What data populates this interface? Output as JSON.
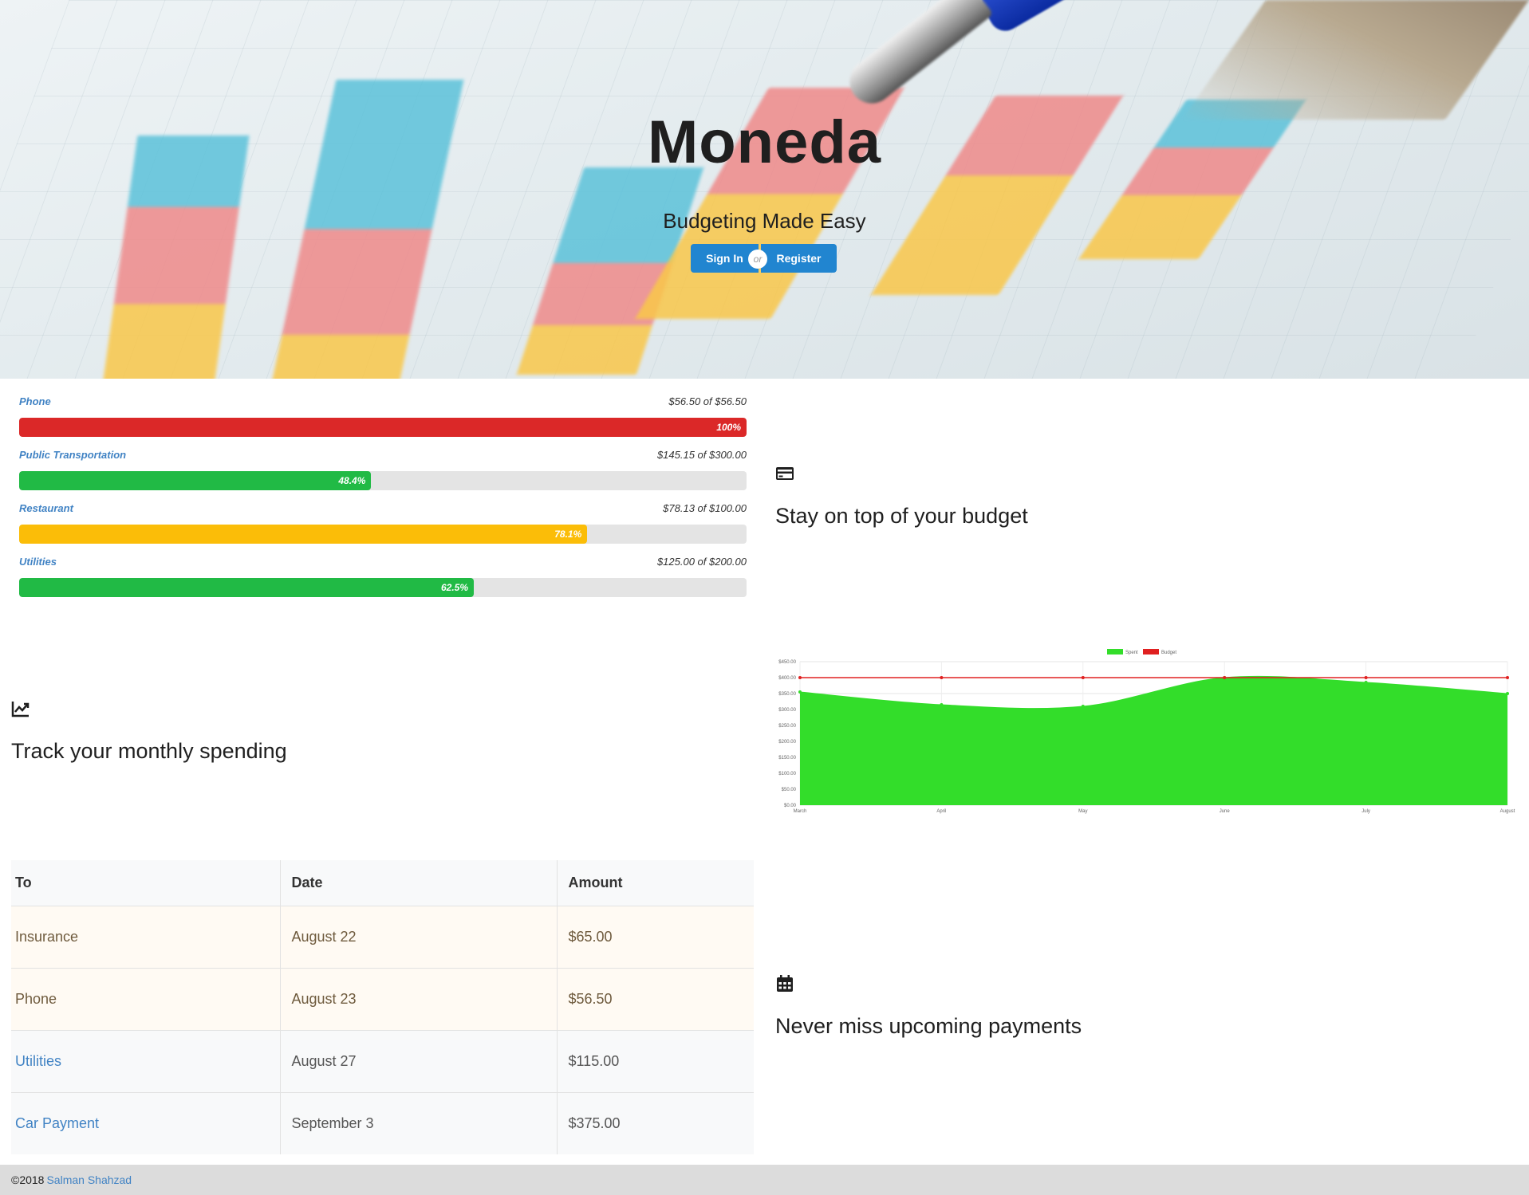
{
  "hero": {
    "title": "Moneda",
    "subtitle": "Budgeting Made Easy",
    "signin_label": "Sign In",
    "or_label": "or",
    "register_label": "Register"
  },
  "budget": {
    "items": [
      {
        "name": "Phone",
        "amount": "$56.50 of $56.50",
        "percent_label": "100%",
        "fraction": 1.0,
        "color": "#db2828"
      },
      {
        "name": "Public Transportation",
        "amount": "$145.15 of $300.00",
        "percent_label": "48.4%",
        "fraction": 0.484,
        "color": "#21ba45"
      },
      {
        "name": "Restaurant",
        "amount": "$78.13 of $100.00",
        "percent_label": "78.1%",
        "fraction": 0.781,
        "color": "#fbbd08"
      },
      {
        "name": "Utilities",
        "amount": "$125.00 of $200.00",
        "percent_label": "62.5%",
        "fraction": 0.625,
        "color": "#21ba45"
      }
    ]
  },
  "features": {
    "budget": {
      "icon": "credit-card-icon",
      "title": "Stay on top of your budget"
    },
    "spending": {
      "icon": "line-chart-icon",
      "title": "Track your monthly spending"
    },
    "payments": {
      "icon": "calendar-icon",
      "title": "Never miss upcoming payments"
    }
  },
  "chart_data": {
    "type": "line",
    "categories": [
      "March",
      "April",
      "May",
      "June",
      "July",
      "August"
    ],
    "series": [
      {
        "name": "Spent",
        "values": [
          355,
          315,
          310,
          400,
          385,
          350
        ],
        "color": "#33dd2a",
        "fill": true
      },
      {
        "name": "Budget",
        "values": [
          400,
          400,
          400,
          400,
          400,
          400
        ],
        "color": "#e02020",
        "fill": false
      }
    ],
    "ylim": [
      0,
      450
    ],
    "yticks": [
      "$0.00",
      "$50.00",
      "$100.00",
      "$150.00",
      "$200.00",
      "$250.00",
      "$300.00",
      "$350.00",
      "$400.00",
      "$450.00"
    ],
    "legend": "top",
    "grid": true
  },
  "payments_table": {
    "headers": [
      "To",
      "Date",
      "Amount"
    ],
    "rows": [
      {
        "to": "Insurance",
        "date": "August 22",
        "amount": "$65.00",
        "style": "warn"
      },
      {
        "to": "Phone",
        "date": "August 23",
        "amount": "$56.50",
        "style": "warn"
      },
      {
        "to": "Utilities",
        "date": "August 27",
        "amount": "$115.00",
        "style": "plain"
      },
      {
        "to": "Car Payment",
        "date": "September 3",
        "amount": "$375.00",
        "style": "plain"
      }
    ]
  },
  "footer": {
    "copyright": "©2018",
    "author": "Salman Shahzad"
  }
}
